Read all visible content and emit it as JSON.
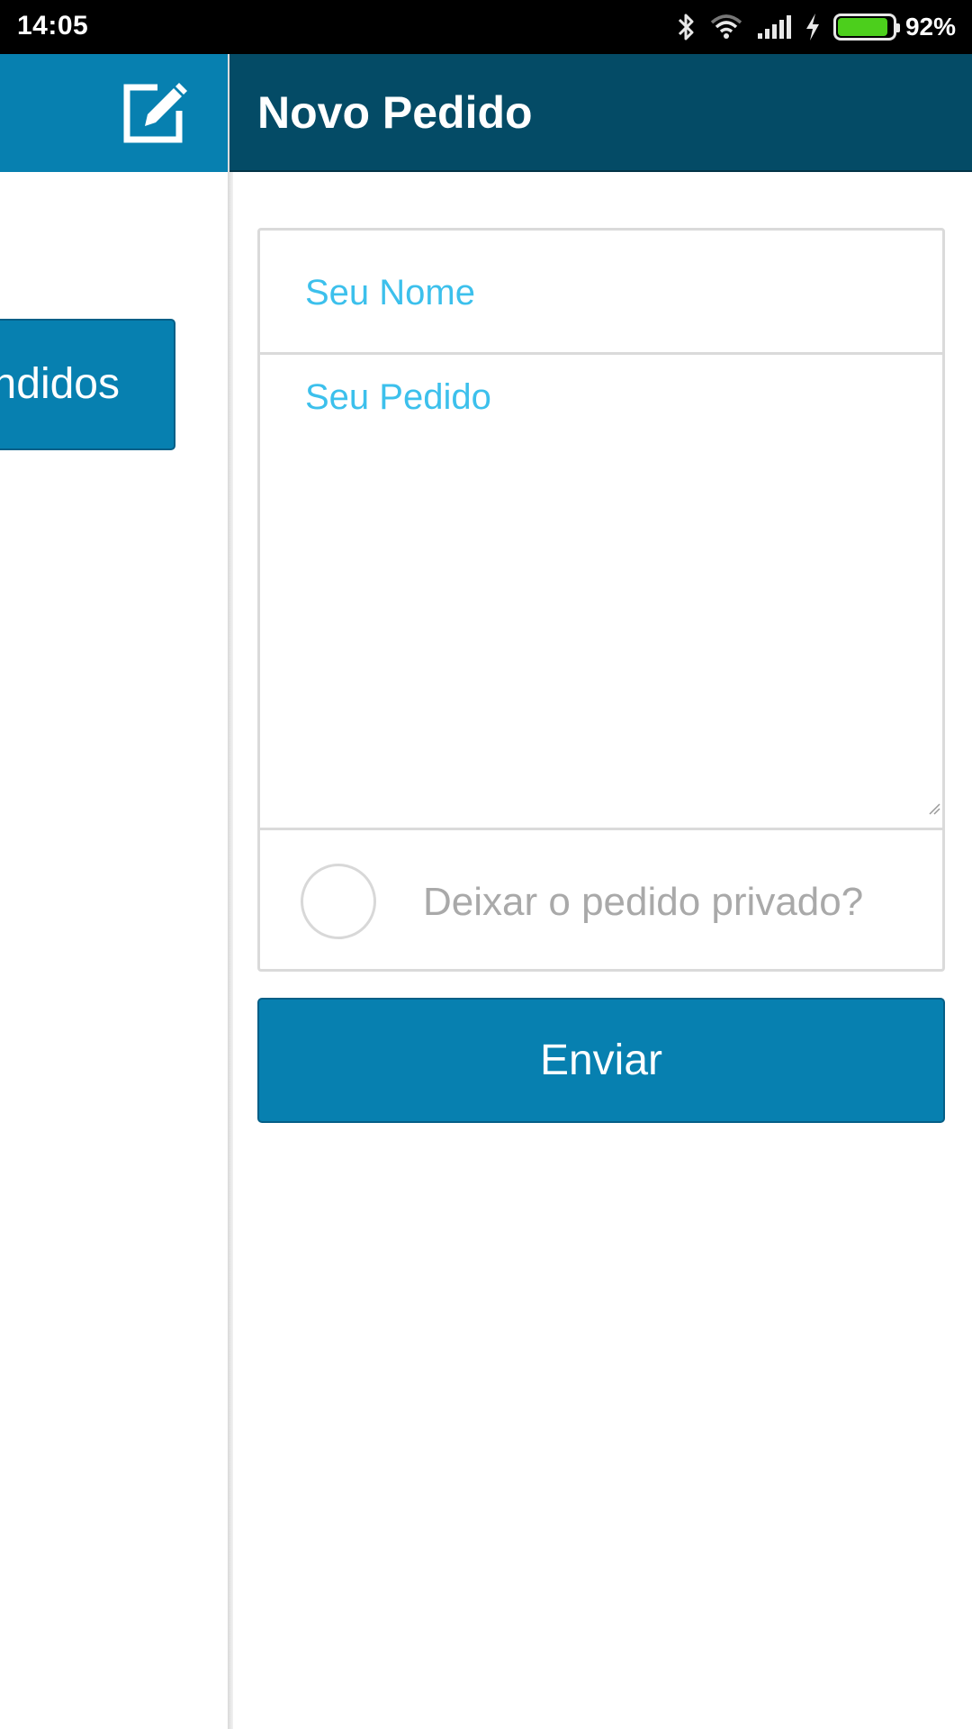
{
  "status_bar": {
    "time": "14:05",
    "battery_percent": "92%",
    "battery_level": 0.92,
    "icons": [
      "bluetooth-icon",
      "wifi-icon",
      "signal-icon",
      "charging-icon",
      "battery-icon"
    ]
  },
  "drawer": {
    "header_icon": "edit-icon",
    "button_label": "ndidos"
  },
  "app_bar": {
    "title": "Novo Pedido"
  },
  "form": {
    "name_placeholder": "Seu Nome",
    "order_placeholder": "Seu Pedido",
    "private_label": "Deixar o pedido privado?",
    "private_checked": false,
    "submit_label": "Enviar"
  },
  "colors": {
    "primary": "#0780b0",
    "app_bar": "#044b66",
    "placeholder": "#3cc0ec",
    "muted_text": "#a9a9a9",
    "border": "#dadada",
    "battery_fill": "#4ccf1c"
  }
}
